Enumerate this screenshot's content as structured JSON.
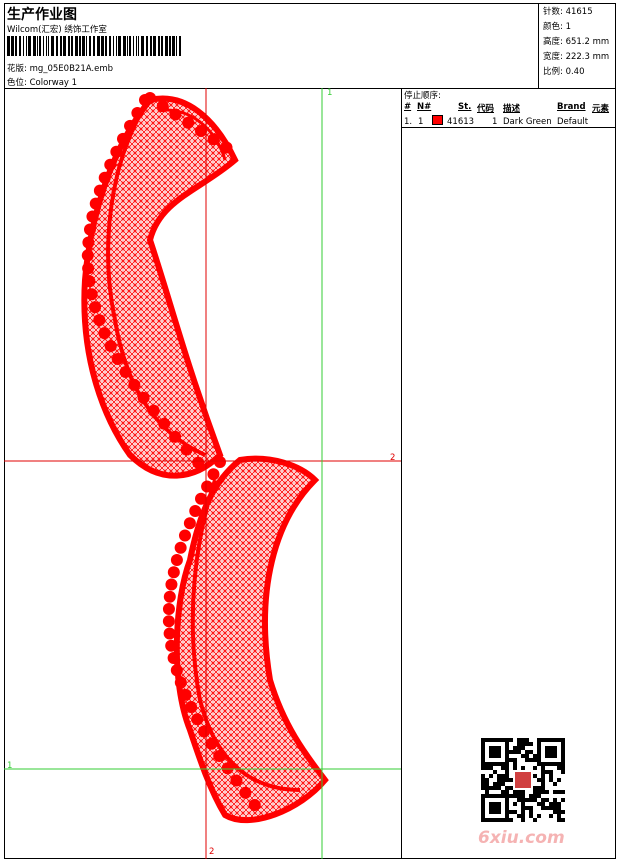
{
  "header": {
    "title": "生产作业图",
    "company": "Wilcom(汇宏) 绣饰工作室",
    "design_label": "花版: mg_05E0B21A.emb",
    "colorway_label": "色位: Colorway 1"
  },
  "stats": {
    "stitches": "针数: 41615",
    "colors": "颜色: 1",
    "height": "高度: 651.2 mm",
    "width": "宽度: 222.3 mm",
    "scale": "比例: 0.40"
  },
  "stops": {
    "title": "停止顺序:",
    "headers": [
      "#",
      "N#",
      "St.",
      "代码",
      "描述",
      "Brand",
      "元素"
    ],
    "rows": [
      {
        "index": "1.",
        "needle": "1",
        "stitches": "41613",
        "code": "1",
        "description": "Dark Green",
        "brand": "Default",
        "element": "",
        "color": "#ff0000"
      }
    ]
  },
  "guides": {
    "top_green": "1",
    "right_red": "2",
    "left_green": "1",
    "bottom_red": "2",
    "color_red": "#e00000",
    "color_green": "#33cc33"
  },
  "design_color": "#ff0000",
  "watermark": "6xiu.com"
}
